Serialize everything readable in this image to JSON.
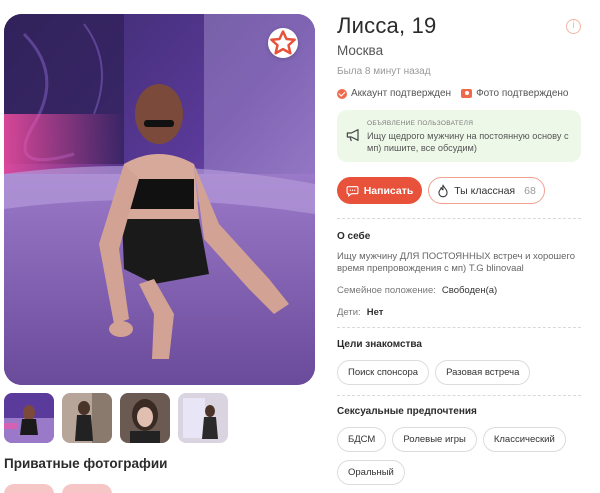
{
  "profile": {
    "name_age": "Лисса, 19",
    "city": "Москва",
    "last_seen": "Была 8 минут назад",
    "info_icon": "info-icon"
  },
  "verification": {
    "account": "Аккаунт подтвержден",
    "photo": "Фото подтверждено"
  },
  "announcement": {
    "title": "ОБЪЯВЛЕНИЕ ПОЛЬЗОВАТЕЛЯ",
    "text": "Ищу щедрого мужчину на постоянную основу с мп) пишите, все обсудим)"
  },
  "actions": {
    "write_label": "Написать",
    "like_label": "Ты классная",
    "like_count": "68"
  },
  "about": {
    "title": "О себе",
    "text": "Ищу мужчину ДЛЯ ПОСТОЯННЫХ встреч и хорошего время препровождения с мп) T.G blinovaal",
    "marital_label": "Семейное положение:",
    "marital_value": "Свободен(а)",
    "kids_label": "Дети:",
    "kids_value": "Нет"
  },
  "goals": {
    "title": "Цели знакомства",
    "items": [
      "Поиск спонсора",
      "Разовая встреча"
    ]
  },
  "preferences": {
    "title": "Сексуальные предпочтения",
    "items": [
      "БДСМ",
      "Ролевые игры",
      "Классический",
      "Оральный"
    ]
  },
  "gallery": {
    "private_title": "Приватные фотографии"
  },
  "colors": {
    "accent": "#e8513a",
    "announce_bg": "#eef8e9"
  }
}
